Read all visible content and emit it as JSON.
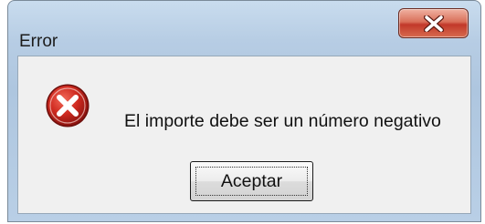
{
  "window": {
    "title": "Error",
    "close_icon": "close-x-icon",
    "close_color": "#c9422f"
  },
  "content": {
    "icon": "error-icon",
    "icon_color": "#c0211a",
    "message": "El importe debe ser un número negativo"
  },
  "buttons": {
    "ok_label": "Aceptar"
  }
}
